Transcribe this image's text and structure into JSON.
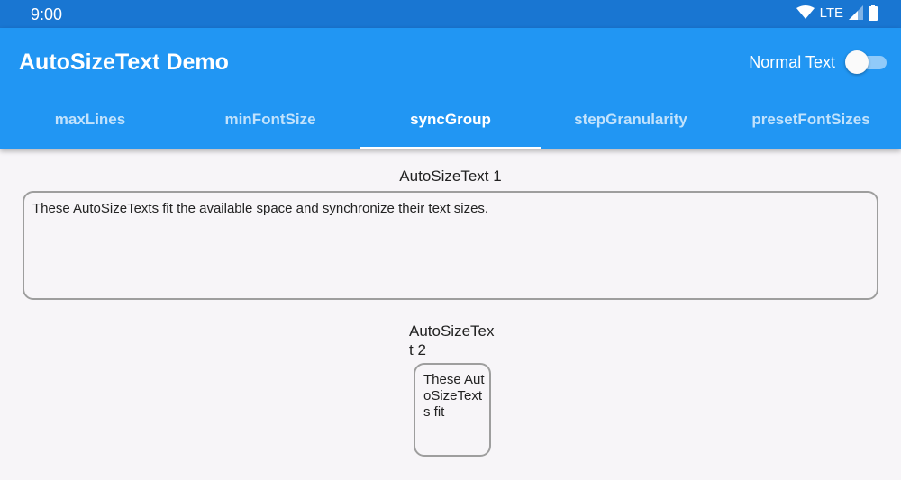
{
  "status_bar": {
    "time": "9:00",
    "network": "LTE",
    "icons": [
      "wifi-icon",
      "cell-signal-icon",
      "battery-icon"
    ]
  },
  "app_bar": {
    "title": "AutoSizeText Demo",
    "toggle_label": "Normal Text",
    "toggle_on": false
  },
  "tabs": [
    {
      "label": "maxLines",
      "active": false
    },
    {
      "label": "minFontSize",
      "active": false
    },
    {
      "label": "syncGroup",
      "active": true
    },
    {
      "label": "stepGranularity",
      "active": false
    },
    {
      "label": "presetFontSizes",
      "active": false
    }
  ],
  "content": {
    "example1": {
      "label": "AutoSizeText 1",
      "text": "These AutoSizeTexts fit the available space and synchronize their text sizes."
    },
    "example2": {
      "label": "AutoSizeText 2",
      "text": "These AutoSizeTexts fit"
    }
  },
  "colors": {
    "status_bar": "#1976d2",
    "primary": "#2196f3",
    "background": "#f7f5f8",
    "border": "#9e9e9e"
  }
}
